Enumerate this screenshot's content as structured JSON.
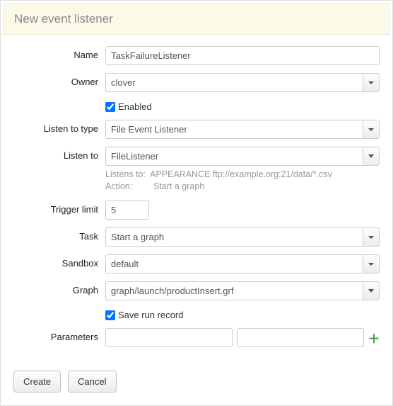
{
  "header": {
    "title": "New event listener"
  },
  "labels": {
    "name": "Name",
    "owner": "Owner",
    "enabled": "Enabled",
    "listen_to_type": "Listen to type",
    "listen_to": "Listen to",
    "trigger_limit": "Trigger limit",
    "task": "Task",
    "sandbox": "Sandbox",
    "graph": "Graph",
    "save_run_record": "Save run record",
    "parameters": "Parameters"
  },
  "values": {
    "name": "TaskFailureListener",
    "owner": "clover",
    "enabled": true,
    "listen_to_type": "File Event Listener",
    "listen_to": "FileListener",
    "trigger_limit": "5",
    "task": "Start a graph",
    "sandbox": "default",
    "graph": "graph/launch/productInsert.grf",
    "save_run_record": true,
    "param_key": "",
    "param_value": ""
  },
  "hints": {
    "listens_to_label": "Listens to:",
    "listens_to_value": "APPEARANCE ftp://example.org:21/data/*.csv",
    "action_label": "Action:",
    "action_value": "Start a graph"
  },
  "footer": {
    "create": "Create",
    "cancel": "Cancel"
  }
}
